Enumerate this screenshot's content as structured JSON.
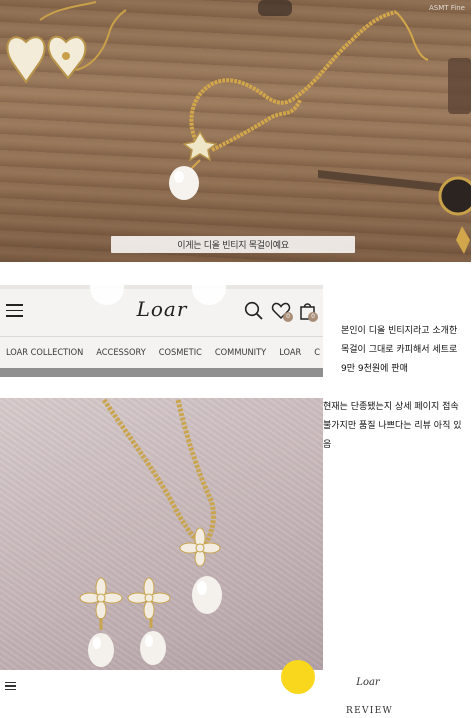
{
  "video": {
    "subtitle": "이게는 디올 빈티지 목걸이예요",
    "watermark": "ASMT Fine"
  },
  "shop": {
    "logo": "Loar",
    "nav": [
      "LOAR COLLECTION",
      "ACCESSORY",
      "COSMETIC",
      "COMMUNITY",
      "LOAR",
      "C"
    ],
    "wishlist_count": "0",
    "cart_count": "0"
  },
  "text1": {
    "line1": "본인이 디올 빈티지라고 소개한",
    "line2": "목걸이 그대로 카피해서 세트로",
    "line3": "9만 9천원에 판매"
  },
  "text2": {
    "line1": "현재는 단종됐는지 상세 페이지 접속",
    "line2": "불가지만 품질 나쁘다는 리뷰 아직 있",
    "line3": "음"
  },
  "footer": {
    "logo": "Loar",
    "review": "REVIEW"
  },
  "icons": {
    "menu": "hamburger-icon",
    "search": "search-icon",
    "wishlist": "heart-icon",
    "cart": "shopping-bag-icon"
  },
  "colors": {
    "badge": "#a98e78",
    "floating_button": "#f8d71c"
  }
}
